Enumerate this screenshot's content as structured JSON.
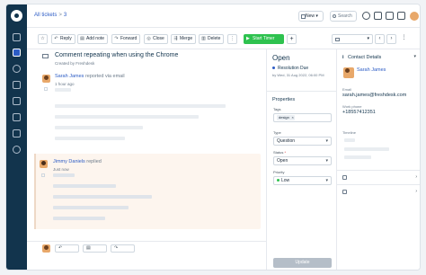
{
  "breadcrumb": {
    "root": "All tickets",
    "separator": ">",
    "ticket_number": "3"
  },
  "topbar": {
    "new_label": "New",
    "search_label": "Search"
  },
  "toolbar": {
    "reply": "Reply",
    "add_note": "Add note",
    "forward": "Forward",
    "close": "Close",
    "merge": "Merge",
    "delete": "Delete",
    "more": "⋮",
    "start_timer": "Start Timer",
    "add": "+",
    "prev": "‹",
    "next": "›"
  },
  "ticket": {
    "subject": "Comment repeating when using the Chrome",
    "created_by": "Created by Freshdesk",
    "first_message": {
      "sender": "Sarah James",
      "action": "reported via email",
      "time": "1 hour ago"
    },
    "reply_message": {
      "sender": "Jimmy Daniels",
      "action": "replied",
      "time": "Just now"
    }
  },
  "properties": {
    "status_title": "Open",
    "due_label": "Resolution Due",
    "due_date": "by Wed, 31 Aug 2022, 06:00 PM",
    "heading": "Properties",
    "tags_label": "Tags",
    "tag_value": "design",
    "tag_remove": "×",
    "type_label": "Type",
    "type_value": "Question",
    "status_label": "Status",
    "status_value": "Open",
    "priority_label": "Priority",
    "priority_value": "Low",
    "required_mark": "*",
    "update_label": "Update",
    "priority_color": "#2ec24f"
  },
  "contact": {
    "heading": "Contact Details",
    "name": "Sarah James",
    "email_label": "Email",
    "email": "sarah.james@freshdesk.com",
    "phone_label": "Work phone",
    "phone": "+18557412351",
    "timeline_label": "Timeline"
  },
  "colors": {
    "accent": "#2c5cc5",
    "timer": "#2ec24f",
    "rail": "#12344d"
  }
}
